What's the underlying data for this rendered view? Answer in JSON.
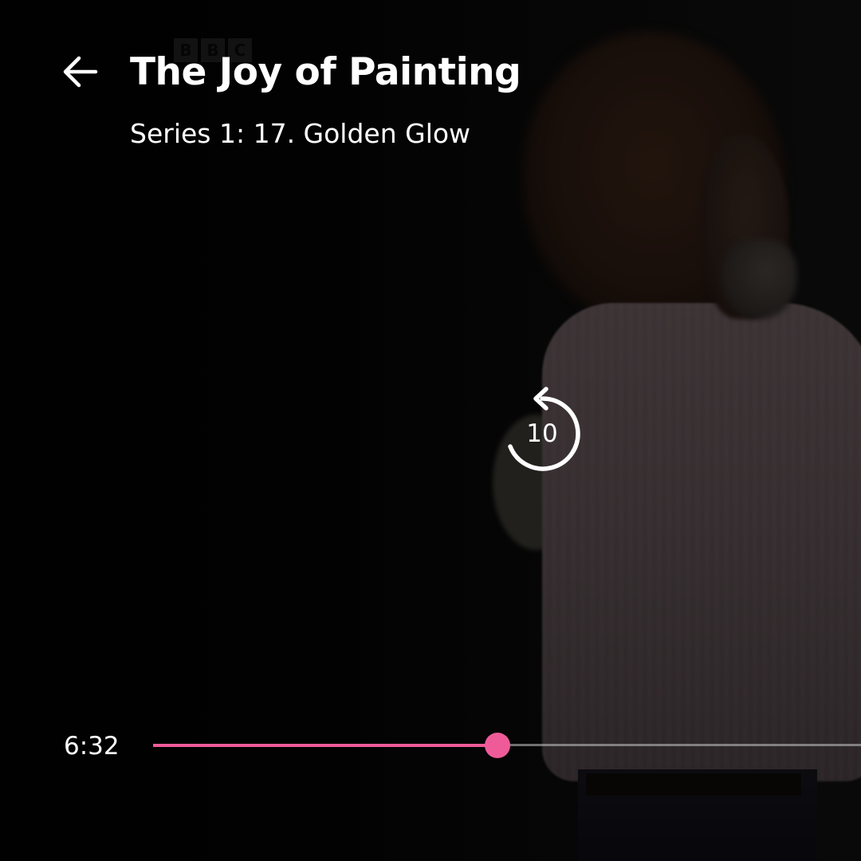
{
  "header": {
    "back_icon": "arrow-left-icon",
    "title": "The Joy of Painting",
    "subtitle": "Series 1: 17. Golden Glow"
  },
  "video": {
    "watermark_letters": [
      "B",
      "B",
      "C"
    ]
  },
  "controls": {
    "replay_icon": "rewind-10-icon",
    "replay_label": "10"
  },
  "progress": {
    "elapsed": "6:32",
    "fraction": 0.486,
    "accent_color": "#ef5b99"
  }
}
